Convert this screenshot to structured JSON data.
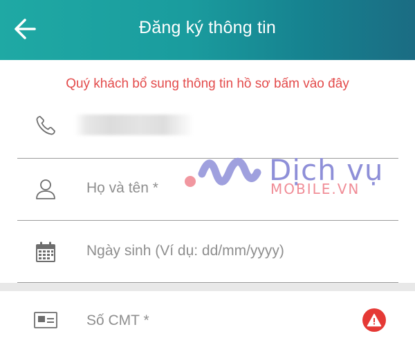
{
  "header": {
    "title": "Đăng ký thông tin",
    "back_icon": "arrow-left-icon",
    "gradient_start": "#1fa9a4",
    "gradient_end": "#1b6c83"
  },
  "notice": {
    "text": "Quý khách bổ sung thông tin hồ sơ bấm vào đây",
    "color": "#e34b4b"
  },
  "form": {
    "phone": {
      "icon": "phone-icon",
      "value": ""
    },
    "full_name": {
      "icon": "person-icon",
      "placeholder": "Họ và tên *"
    },
    "birth_date": {
      "icon": "calendar-icon",
      "placeholder": "Ngày sinh (Ví dụ: dd/mm/yyyy)"
    },
    "id_card": {
      "icon": "id-card-icon",
      "placeholder": "Số CMT *",
      "status_icon": "warning-icon",
      "status_color": "#e53935"
    }
  },
  "watermark": {
    "line1": "Dịch vụ",
    "line2": "MOBILE.VN"
  }
}
